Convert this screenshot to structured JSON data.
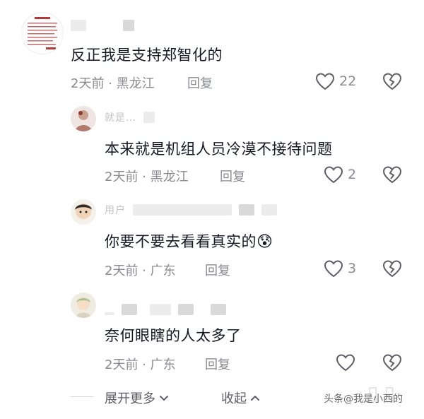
{
  "comments": [
    {
      "text": "反正我是支持郑智化的",
      "time": "2天前",
      "location": "黑龙江",
      "reply_label": "回复",
      "likes": "22"
    },
    {
      "username_partial": "就是…",
      "text": "本来就是机组人员冷漠不接待问题",
      "time": "2天前",
      "location": "黑龙江",
      "reply_label": "回复",
      "likes": "2"
    },
    {
      "username_partial": "用户",
      "text": "你要不要去看看真实的",
      "emoji": "😰",
      "time": "2天前",
      "location": "广东",
      "reply_label": "回复",
      "likes": "3"
    },
    {
      "text": "奈何眼瞎的人太多了",
      "time": "2天前",
      "location": "广东",
      "reply_label": "回复",
      "likes": ""
    }
  ],
  "meta_separator": "·",
  "footer": {
    "expand_label": "展开更多",
    "collapse_label": "收起",
    "watermark": "头条@我是小西的"
  },
  "colors": {
    "text": "#161823",
    "meta": "#8a8b91",
    "icon": "#5e5f66"
  }
}
